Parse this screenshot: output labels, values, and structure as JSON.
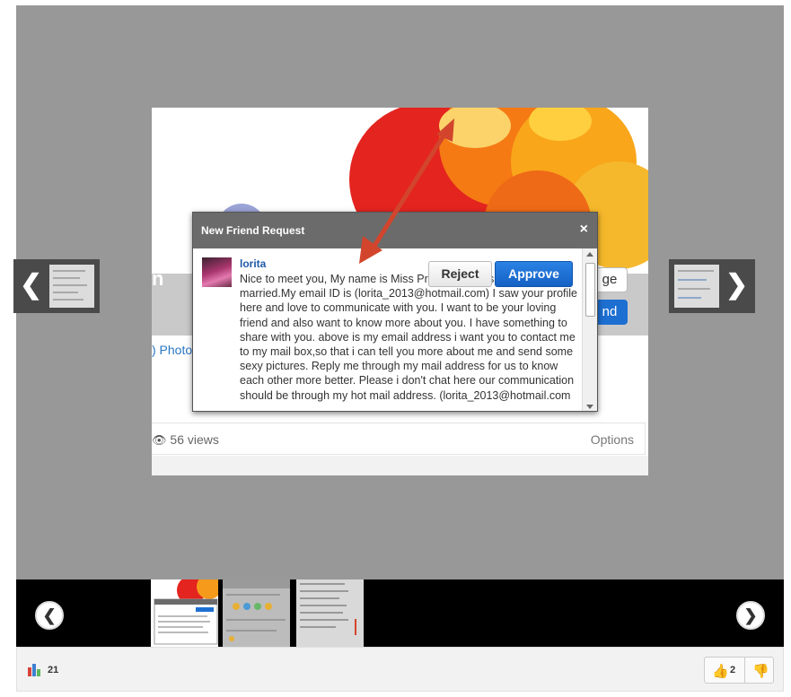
{
  "modal": {
    "title": "New Friend Request",
    "close_symbol": "×",
    "sender_name": "lorita",
    "message": "Nice to meet you, My name is Miss Princes Lorita,single never married.My email ID is (lorita_2013@hotmail.com) I saw your profile here and love to communicate with you. I want to be your loving friend and also want to know more about you. I have something to share with you. above is my email address i want you to contact me to my mail box,so that i can tell you more about me and send some sexy pictures. Reply me through my mail address for us to know each other more better. Please i don't chat here our communication should be through my hot mail address. (lorita_2013@hotmail.com",
    "reject_label": "Reject",
    "approve_label": "Approve"
  },
  "background": {
    "heading_fragment": "n",
    "photos_link": ") Photos",
    "message_button_fragment": "ge",
    "friend_button_fragment": "nd",
    "views_text": "56 views",
    "options_label": "Options"
  },
  "nav": {
    "prev_symbol": "❮",
    "next_symbol": "❯"
  },
  "filmstrip": {
    "prev_symbol": "❮",
    "next_symbol": "❯"
  },
  "action_bar": {
    "poll_count": "21",
    "like_count": "2"
  },
  "colors": {
    "viewer_bg": "#989898",
    "modal_header": "#6b6b6b",
    "approve_blue": "#1561c4",
    "sender_link": "#1f5aa6",
    "annotation_arrow": "#d2452c"
  },
  "icons": [
    "eye-icon",
    "close-icon",
    "chevron-left-icon",
    "chevron-right-icon",
    "poll-icon",
    "thumbs-up-icon",
    "thumbs-down-icon"
  ]
}
